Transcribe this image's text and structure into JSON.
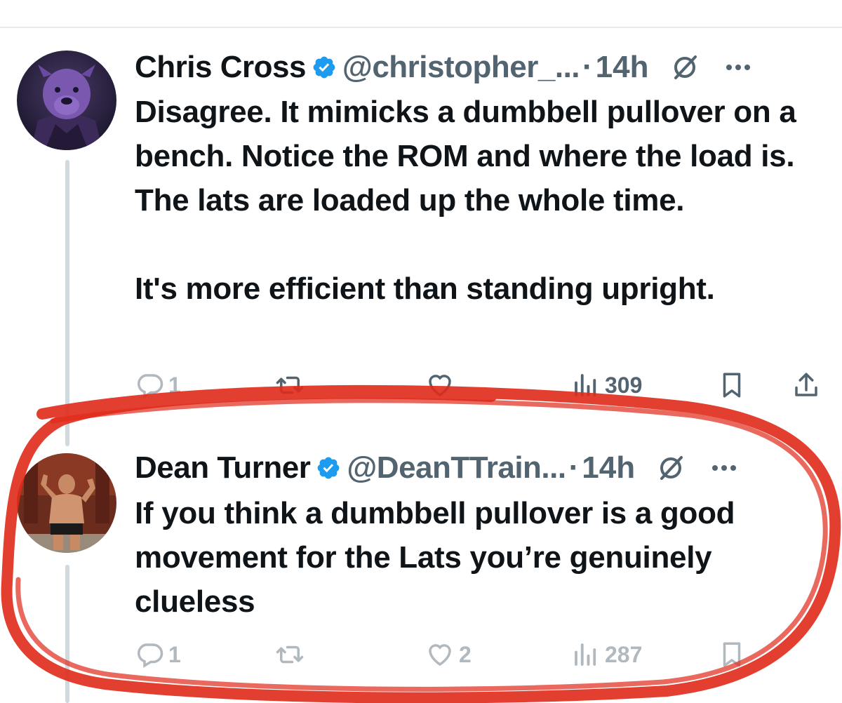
{
  "colors": {
    "text": "#0f1419",
    "secondary": "#536471",
    "verified": "#1d9bf0",
    "thread_line": "#cfd9de",
    "annotation": "#e02a1a"
  },
  "tweets": [
    {
      "author_name": "Chris Cross",
      "handle": "@christopher_...",
      "separator": "·",
      "time": "14h",
      "avatar_icon": "purple-pitbull-avatar",
      "text": "Disagree. It mimicks a dumbbell pullover on a bench. Notice the ROM and where the load is. The lats are loaded up the whole time.\n\nIt's more efficient than standing upright.",
      "replies": "1",
      "retweets": "",
      "likes": "",
      "views": "309"
    },
    {
      "author_name": "Dean Turner",
      "handle": "@DeanTTrain...",
      "separator": "·",
      "time": "14h",
      "avatar_icon": "gym-selfie-avatar",
      "text": "If you think a dumbbell pullover is a good movement for the Lats you’re genuinely clueless",
      "replies": "1",
      "retweets": "",
      "likes": "2",
      "views": "287"
    }
  ]
}
